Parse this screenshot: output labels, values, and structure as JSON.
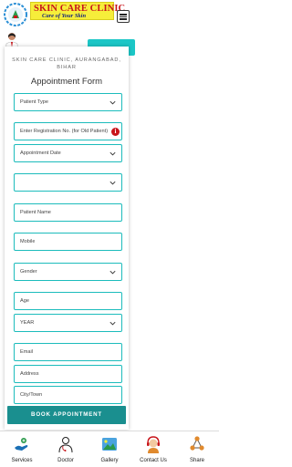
{
  "header": {
    "brand_title": "SKIN CARE CLINIC",
    "brand_tagline": "Care of Your Skin",
    "colors": {
      "brand_red": "#c8151b",
      "brand_yellow": "#f6ee3a",
      "accent_teal": "#1cbcbc"
    }
  },
  "form": {
    "clinic_line": "SKIN CARE CLINIC, AURANGABAD, BIHAR",
    "title": "Appointment Form",
    "fields": [
      {
        "placeholder": "Patient Type",
        "type": "select"
      },
      {
        "placeholder": "Enter Registration No. (for Old Patient)",
        "type": "input",
        "has_info": true
      },
      {
        "placeholder": "Appointment Date",
        "type": "select"
      },
      {
        "placeholder": "",
        "type": "select"
      },
      {
        "placeholder": "Patient Name",
        "type": "input"
      },
      {
        "placeholder": "Mobile",
        "type": "input"
      },
      {
        "placeholder": "Gender",
        "type": "select"
      },
      {
        "placeholder": "Age",
        "type": "input"
      },
      {
        "placeholder": "YEAR",
        "type": "select"
      },
      {
        "placeholder": "Email",
        "type": "input"
      },
      {
        "placeholder": "Address",
        "type": "input"
      },
      {
        "placeholder": "City/Town",
        "type": "input"
      }
    ],
    "submit_label": "BOOK APPOINTMENT"
  },
  "bottom_nav": {
    "items": [
      {
        "label": "Services",
        "icon": "services-icon"
      },
      {
        "label": "Doctor",
        "icon": "doctor-icon"
      },
      {
        "label": "Gallery",
        "icon": "gallery-icon"
      },
      {
        "label": "Contact Us",
        "icon": "contact-icon"
      },
      {
        "label": "Share",
        "icon": "share-icon"
      }
    ]
  }
}
